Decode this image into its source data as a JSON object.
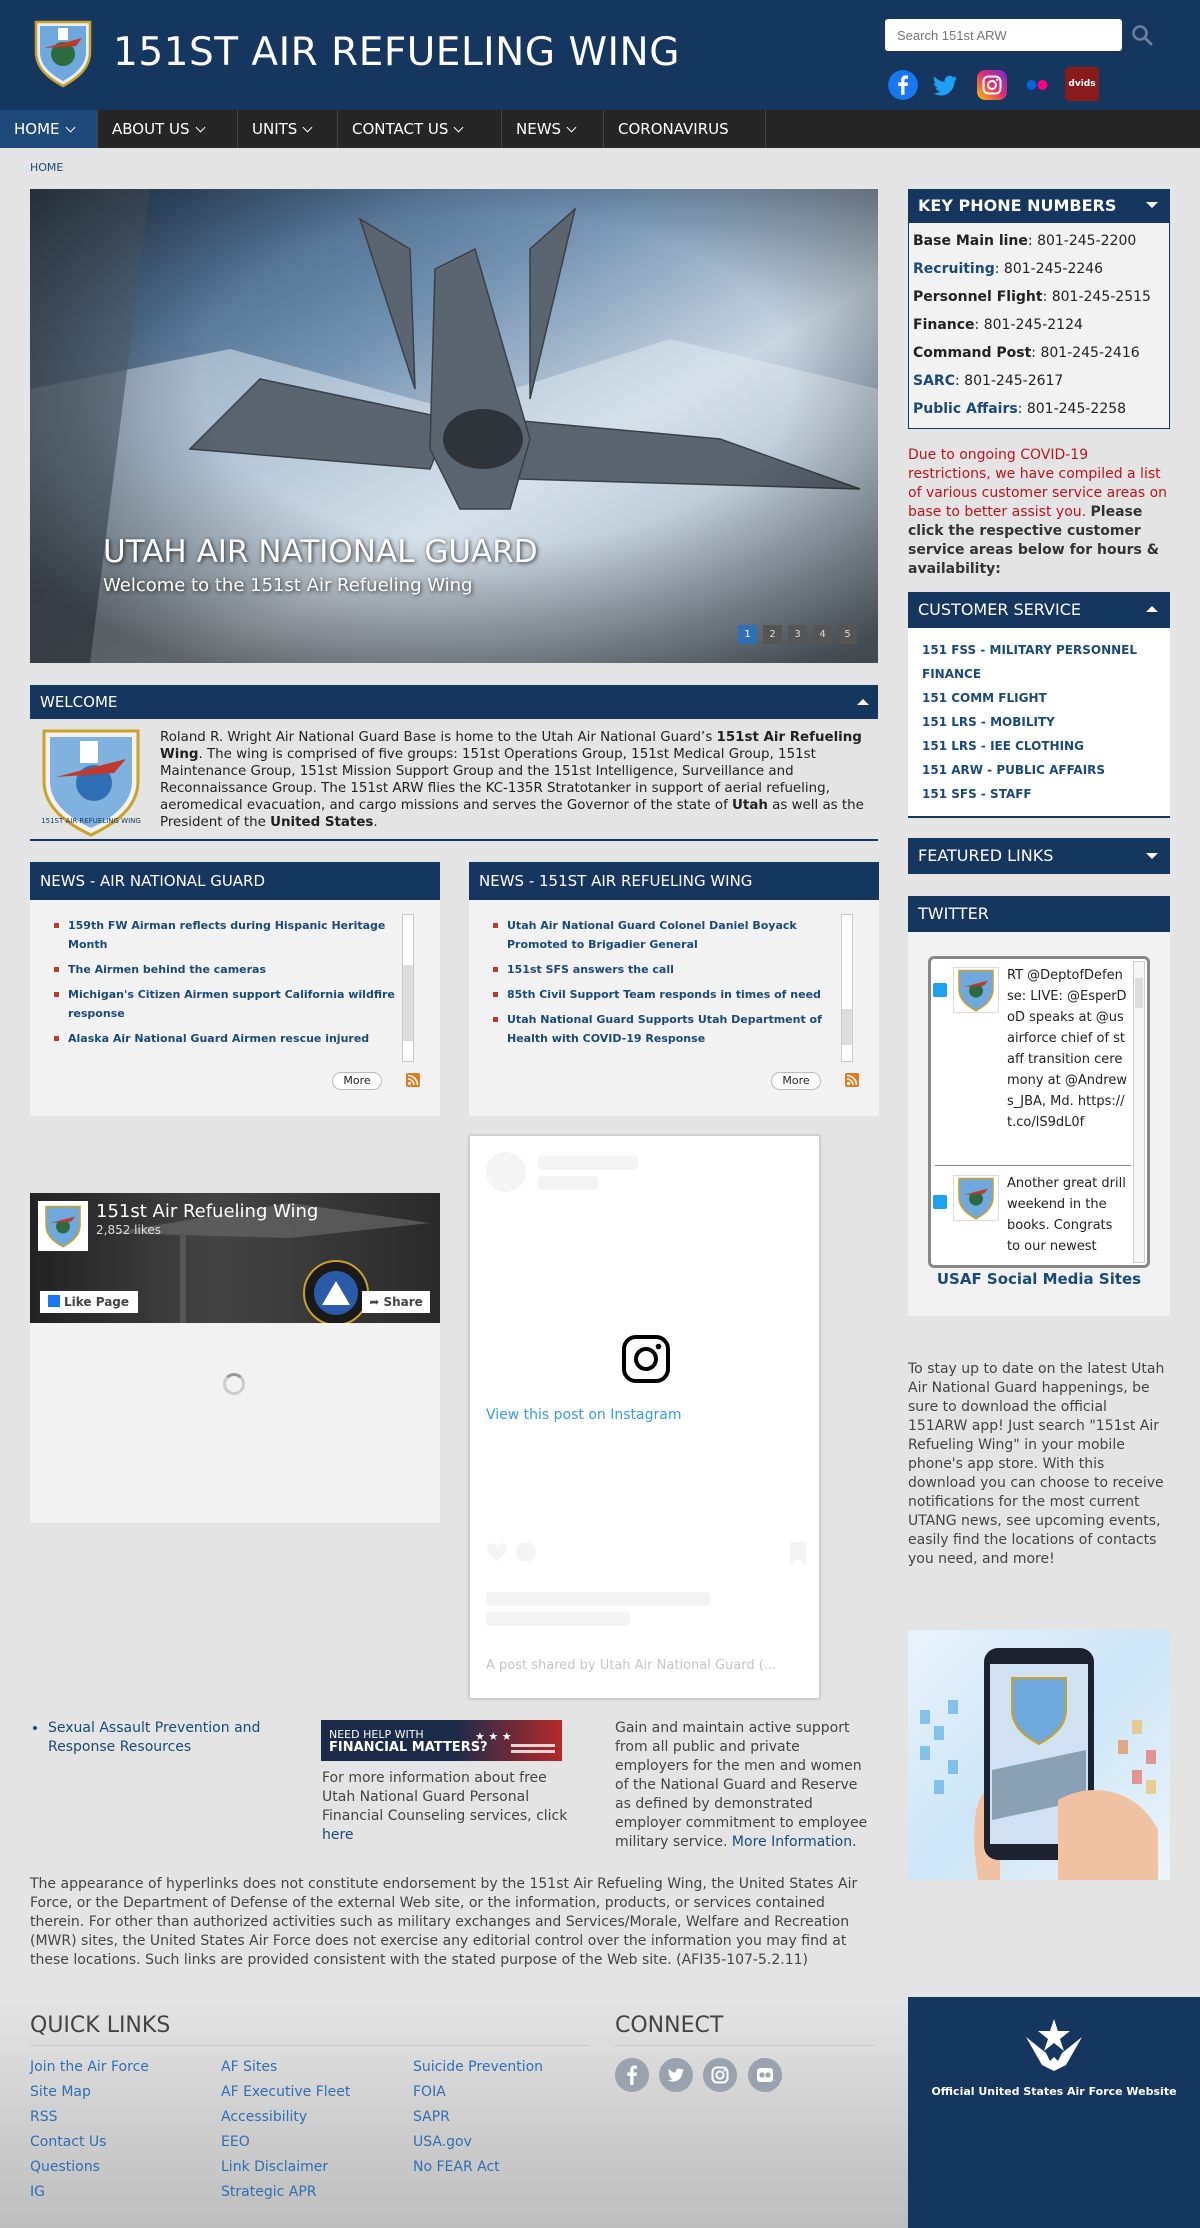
{
  "header": {
    "title": "151ST AIR REFUELING WING",
    "search_placeholder": "Search 151st ARW",
    "social_icons": [
      "facebook-icon",
      "twitter-icon",
      "instagram-icon",
      "flickr-icon",
      "dvids-icon"
    ],
    "dvids_label": "dvids"
  },
  "nav": {
    "items": [
      {
        "label": "HOME",
        "dropdown": true
      },
      {
        "label": "ABOUT US",
        "dropdown": true
      },
      {
        "label": "UNITS",
        "dropdown": true
      },
      {
        "label": "CONTACT US",
        "dropdown": true
      },
      {
        "label": "NEWS",
        "dropdown": true
      },
      {
        "label": "CORONAVIRUS",
        "dropdown": false
      }
    ]
  },
  "breadcrumb": "HOME",
  "hero": {
    "title": "UTAH AIR NATIONAL GUARD",
    "subtitle": "Welcome to the 151st Air Refueling Wing",
    "slides": [
      "1",
      "2",
      "3",
      "4",
      "5"
    ],
    "active_slide": 1
  },
  "welcome": {
    "heading": "WELCOME",
    "t1": "Roland R. Wright Air National Guard Base is home to the Utah Air National Guard’s ",
    "t2": "151st Air Refueling Wing",
    "t3": ". The wing is comprised of five groups: 151st Operations Group, 151st Medical Group, 151st Maintenance Group, 151st Mission Support Group and the 151st Intelligence, Surveillance and Reconnaissance Group. The 151st ARW flies the KC-135R Stratotanker in support of aerial refueling, aeromedical evacuation, and cargo missions and serves the Governor of the state of ",
    "t4": "Utah",
    "t5": " as well as the President of the ",
    "t6": "United States",
    "t7": "."
  },
  "news_ang": {
    "heading": "NEWS - AIR NATIONAL GUARD",
    "items": [
      "159th FW Airman reflects during Hispanic Heritage Month",
      "The Airmen behind the cameras",
      "Michigan's Citizen Airmen support California wildfire response",
      "Alaska Air National Guard Airmen rescue injured"
    ],
    "more": "More"
  },
  "news_151": {
    "heading": "NEWS - 151ST AIR REFUELING WING",
    "items": [
      "Utah Air National Guard Colonel Daniel Boyack Promoted to Brigadier General",
      "151st SFS answers the call",
      "85th Civil Support Team responds in times of need",
      "Utah National Guard Supports Utah Department of Health with COVID-19 Response"
    ],
    "more": "More"
  },
  "facebook": {
    "page_name": "151st Air Refueling Wing",
    "likes": "2,852 likes",
    "like_button": "Like Page",
    "share_button": "Share"
  },
  "instagram": {
    "view_post": "View this post on Instagram",
    "credit": "A post shared by Utah Air National Guard (..."
  },
  "phones": {
    "heading": "KEY PHONE NUMBERS",
    "items": [
      {
        "label": "Base Main line",
        "sep": ": ",
        "number": "801-245-2200",
        "link": false
      },
      {
        "label": "Recruiting",
        "sep": ": ",
        "number": "801-245-2246",
        "link": true
      },
      {
        "label": "Personnel Flight",
        "sep": ": ",
        "number": "801-245-2515",
        "link": false
      },
      {
        "label": "Finance",
        "sep": ": ",
        "number": "801-245-2124",
        "link": false
      },
      {
        "label": "Command Post",
        "sep": ": ",
        "number": "801-245-2416",
        "link": false
      },
      {
        "label": "SARC",
        "sep": ": ",
        "number": "801-245-2617",
        "link": true
      },
      {
        "label": "Public Affairs",
        "sep": ": ",
        "number": "801-245-2258",
        "link": true
      }
    ]
  },
  "covid_notice": {
    "red": "Due to ongoing COVID-19 restrictions, we have compiled a list of various customer service areas on base to better assist you. ",
    "bold": "Please click the respective customer service areas below for hours & availability:"
  },
  "customer_service": {
    "heading": "CUSTOMER SERVICE",
    "links": [
      "151 FSS - MILITARY PERSONNEL FINANCE",
      "151 COMM FLIGHT",
      "151 LRS - MOBILITY",
      "151 LRS - IEE CLOTHING",
      "151 ARW - PUBLIC AFFAIRS",
      "151 SFS - STAFF"
    ]
  },
  "featured_links": {
    "heading": "FEATURED LINKS"
  },
  "twitter": {
    "heading": "TWITTER",
    "tweets": [
      "RT @DeptofDefense: LIVE: @EsperDoD speaks at @usairforce chief of staff transition ceremony at @Andrews_JBA, Md. https://t.co/lS9dL0f",
      "Another great drill weekend in the books. Congrats to our newest"
    ],
    "social_sites": "USAF Social Media Sites"
  },
  "app_promo": "To stay up to date on the latest Utah Air National Guard happenings, be sure to download the official 151ARW app! Just search \"151st Air Refueling Wing\" in your mobile phone's app store. With this download you can choose to receive notifications for the most current UTANG news, see upcoming events, easily find the locations of contacts you need, and more!",
  "sapr_link": "Sexual Assault Prevention and Response Resources",
  "financial": {
    "banner_l1": "NEED HELP WITH",
    "banner_l2": "FINANCIAL MATTERS?",
    "text": "For more information about free Utah National Guard Personal Financial Counseling services, click ",
    "link": "here"
  },
  "esgr": {
    "text": "Gain and maintain active support from all public and private employers for the men and women of the National Guard and Reserve as defined by demonstrated employer commitment to employee military service. ",
    "link": "More Information."
  },
  "disclaimer": "The appearance of hyperlinks does not constitute endorsement by the 151st Air Refueling Wing, the United States Air Force, or the Department of Defense of the external Web site, or the information, products, or services contained therein. For other than authorized activities such as military exchanges and Services/Morale, Welfare and Recreation (MWR) sites, the United States Air Force does not exercise any editorial control over the information you may find at these locations. Such links are provided consistent with the stated purpose of the Web site. (AFI35-107-5.2.11)",
  "footer": {
    "quick_links_title": "QUICK LINKS",
    "col1": [
      "Join the Air Force",
      "Site Map",
      "RSS",
      "Contact Us",
      "Questions",
      "IG"
    ],
    "col2": [
      "AF Sites",
      "AF Executive Fleet",
      "Accessibility",
      "EEO",
      "Link Disclaimer",
      "Strategic APR"
    ],
    "col3": [
      "Suicide Prevention",
      "FOIA",
      "SAPR",
      "USA.gov",
      "No FEAR Act"
    ],
    "connect_title": "CONNECT",
    "connect_icons": [
      "facebook-icon",
      "twitter-icon",
      "instagram-icon",
      "flickr-icon"
    ],
    "usaf_label": "Official United States Air Force Website"
  },
  "colors": {
    "header_bg": "#14365f",
    "nav_bg": "#262626",
    "nav_active": "#1d4a7a",
    "link": "#1a4a7a",
    "alert_red": "#c0141c",
    "page_bg": "#e4e4e4"
  }
}
